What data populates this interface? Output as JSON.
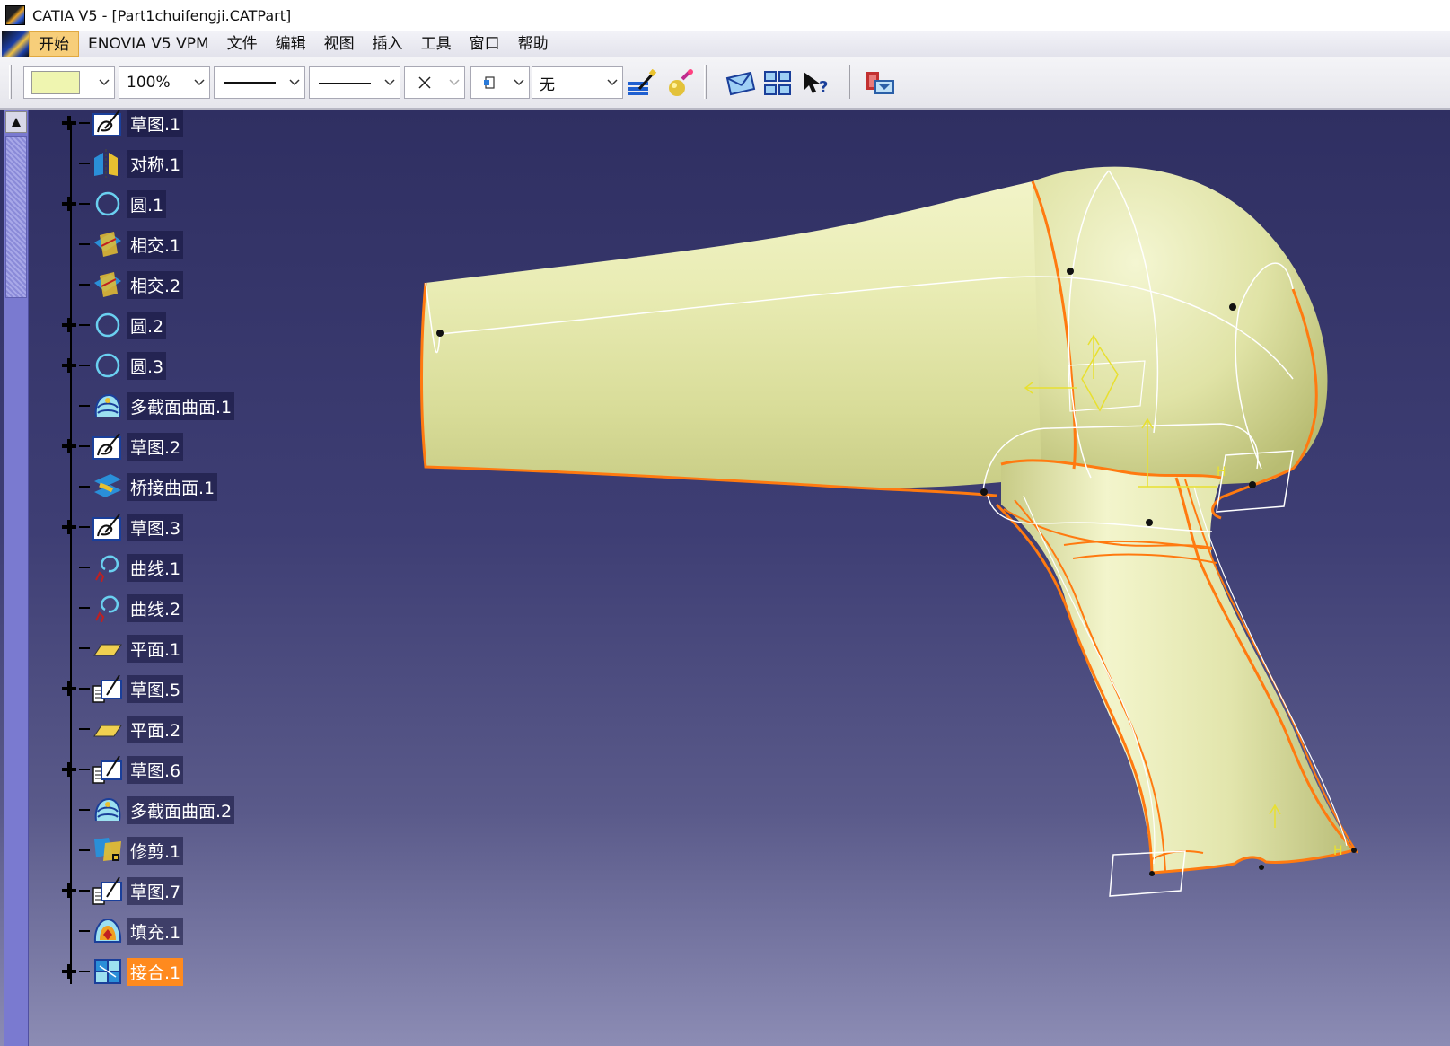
{
  "window": {
    "title": "CATIA V5 - [Part1chuifengji.CATPart]"
  },
  "menubar": {
    "items": [
      {
        "label": "开始",
        "active": true
      },
      {
        "label": "ENOVIA V5 VPM"
      },
      {
        "label": "文件"
      },
      {
        "label": "编辑"
      },
      {
        "label": "视图"
      },
      {
        "label": "插入"
      },
      {
        "label": "工具"
      },
      {
        "label": "窗口"
      },
      {
        "label": "帮助"
      }
    ]
  },
  "toolbar": {
    "color_swatch": "#eff5b0",
    "transparency": "100%",
    "layer": "无",
    "icons": [
      "paint-brush-icon",
      "apply-material-icon",
      "fly-mode-icon",
      "multi-view-icon",
      "whats-this-icon",
      "catalog-icon"
    ]
  },
  "tree": {
    "nodes": [
      {
        "label": "草图.1",
        "icon": "sketch-icon",
        "expandable": true
      },
      {
        "label": "对称.1",
        "icon": "symmetry-icon",
        "expandable": false
      },
      {
        "label": "圆.1",
        "icon": "circle-icon",
        "expandable": true
      },
      {
        "label": "相交.1",
        "icon": "intersection-icon",
        "expandable": false
      },
      {
        "label": "相交.2",
        "icon": "intersection-icon",
        "expandable": false
      },
      {
        "label": "圆.2",
        "icon": "circle-icon",
        "expandable": true
      },
      {
        "label": "圆.3",
        "icon": "circle-icon",
        "expandable": true
      },
      {
        "label": "多截面曲面.1",
        "icon": "multi-section-surface-icon",
        "expandable": false
      },
      {
        "label": "草图.2",
        "icon": "sketch-icon",
        "expandable": true
      },
      {
        "label": "桥接曲面.1",
        "icon": "blend-surface-icon",
        "expandable": false
      },
      {
        "label": "草图.3",
        "icon": "sketch-icon",
        "expandable": true
      },
      {
        "label": "曲线.1",
        "icon": "curve-icon",
        "expandable": false
      },
      {
        "label": "曲线.2",
        "icon": "curve-icon",
        "expandable": false
      },
      {
        "label": "平面.1",
        "icon": "plane-icon",
        "expandable": false
      },
      {
        "label": "草图.5",
        "icon": "positioned-sketch-icon",
        "expandable": true
      },
      {
        "label": "平面.2",
        "icon": "plane-icon",
        "expandable": false
      },
      {
        "label": "草图.6",
        "icon": "positioned-sketch-icon",
        "expandable": true
      },
      {
        "label": "多截面曲面.2",
        "icon": "multi-section-surface-icon",
        "expandable": false
      },
      {
        "label": "修剪.1",
        "icon": "trim-icon",
        "expandable": false
      },
      {
        "label": "草图.7",
        "icon": "positioned-sketch-icon",
        "expandable": true
      },
      {
        "label": "填充.1",
        "icon": "fill-icon",
        "expandable": false
      },
      {
        "label": "接合.1",
        "icon": "join-icon",
        "expandable": true,
        "selected": true
      }
    ]
  },
  "colors": {
    "viewport_top": "#2f2f62",
    "viewport_bottom": "#8c8cb4",
    "surface": "#e4e7a8",
    "highlight_edge": "#ff7a10",
    "selection": "#ff8a1e"
  }
}
